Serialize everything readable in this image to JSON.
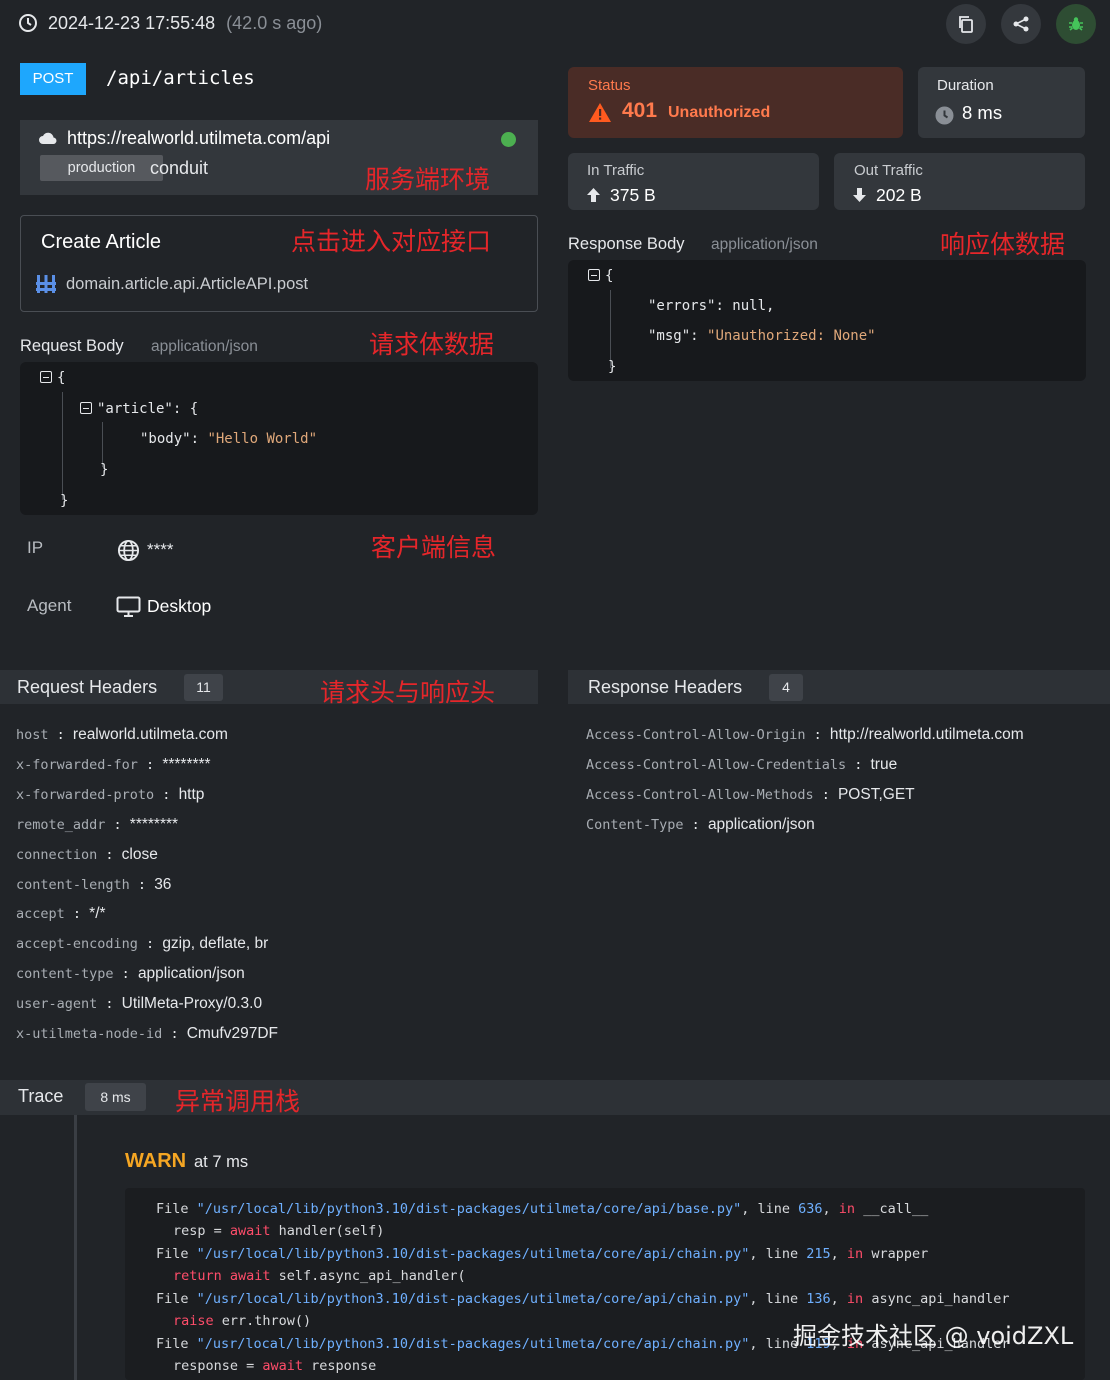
{
  "header": {
    "timestamp": "2024-12-23 17:55:48",
    "ago": "(42.0 s ago)",
    "icons": [
      "clock-icon",
      "copy-icon",
      "share-icon",
      "bug-icon"
    ]
  },
  "request": {
    "method": "POST",
    "path": "/api/articles",
    "method_color": "#1ea7fd"
  },
  "service": {
    "url": "https://realworld.utilmeta.com/api",
    "env": "production",
    "name": "conduit",
    "online_color": "#4caf50"
  },
  "endpoint": {
    "title": "Create Article",
    "ref": "domain.article.api.ArticleAPI.post"
  },
  "request_body": {
    "label": "Request Body",
    "content_type": "application/json",
    "lines": [
      {
        "t": "{"
      },
      {
        "key": "\"article\"",
        "t": ": {"
      },
      {
        "key": "\"body\"",
        "t": ": ",
        "str": "\"Hello World\""
      },
      {
        "t": "}"
      },
      {
        "t": "}"
      }
    ]
  },
  "client": {
    "ip_label": "IP",
    "ip_value": "****",
    "agent_label": "Agent",
    "agent_value": "Desktop"
  },
  "status": {
    "label": "Status",
    "code": "401",
    "text": "Unauthorized",
    "color": "#ff6a2b"
  },
  "duration": {
    "label": "Duration",
    "value": "8 ms"
  },
  "traffic": {
    "in_label": "In Traffic",
    "in_value": "375 B",
    "out_label": "Out Traffic",
    "out_value": "202 B"
  },
  "response_body": {
    "label": "Response Body",
    "content_type": "application/json",
    "lines": [
      {
        "t": "{"
      },
      {
        "key": "\"errors\"",
        "t": ": null,"
      },
      {
        "key": "\"msg\"",
        "t": ": ",
        "str": "\"Unauthorized: None\""
      },
      {
        "t": "}"
      }
    ]
  },
  "request_headers": {
    "title": "Request Headers",
    "count": "11",
    "items": [
      {
        "k": "host",
        "v": "realworld.utilmeta.com"
      },
      {
        "k": "x-forwarded-for",
        "v": "********"
      },
      {
        "k": "x-forwarded-proto",
        "v": "http"
      },
      {
        "k": "remote_addr",
        "v": "********"
      },
      {
        "k": "connection",
        "v": "close"
      },
      {
        "k": "content-length",
        "v": "36"
      },
      {
        "k": "accept",
        "v": "*/*"
      },
      {
        "k": "accept-encoding",
        "v": "gzip, deflate, br"
      },
      {
        "k": "content-type",
        "v": "application/json"
      },
      {
        "k": "user-agent",
        "v": "UtilMeta-Proxy/0.3.0"
      },
      {
        "k": "x-utilmeta-node-id",
        "v": "Cmufv297DF"
      }
    ]
  },
  "response_headers": {
    "title": "Response Headers",
    "count": "4",
    "items": [
      {
        "k": "Access-Control-Allow-Origin",
        "v": "http://realworld.utilmeta.com"
      },
      {
        "k": "Access-Control-Allow-Credentials",
        "v": "true"
      },
      {
        "k": "Access-Control-Allow-Methods",
        "v": "POST,GET"
      },
      {
        "k": "Content-Type",
        "v": "application/json"
      }
    ]
  },
  "trace": {
    "title": "Trace",
    "duration": "8 ms",
    "level": "WARN",
    "at": "at 7 ms",
    "frames": [
      {
        "file": "\"/usr/local/lib/python3.10/dist-packages/utilmeta/core/api/base.py\"",
        "line": "636",
        "func": "__call__",
        "code_kw": "await",
        "code_pre": "resp = ",
        "code_post": " handler(self)"
      },
      {
        "file": "\"/usr/local/lib/python3.10/dist-packages/utilmeta/core/api/chain.py\"",
        "line": "215",
        "func": "wrapper",
        "code_kw": "return await",
        "code_pre": "",
        "code_post": " self.async_api_handler("
      },
      {
        "file": "\"/usr/local/lib/python3.10/dist-packages/utilmeta/core/api/chain.py\"",
        "line": "136",
        "func": "async_api_handler",
        "code_kw": "raise",
        "code_pre": "",
        "code_post": " err.throw()"
      },
      {
        "file": "\"/usr/local/lib/python3.10/dist-packages/utilmeta/core/api/chain.py\"",
        "line": "119",
        "func": "async_api_handler",
        "code_kw": "await",
        "code_pre": "response = ",
        "code_post": " response"
      }
    ]
  },
  "trace_words": {
    "file": "File",
    "line": "line",
    "in": "in"
  },
  "annotations": {
    "server_env": "服务端环境",
    "click_enter": "点击进入对应接口",
    "req_body": "请求体数据",
    "resp_body": "响应体数据",
    "client_info": "客户端信息",
    "headers": "请求头与响应头",
    "trace": "异常调用栈"
  },
  "watermark": "掘金技术社区 @ voidZXL"
}
